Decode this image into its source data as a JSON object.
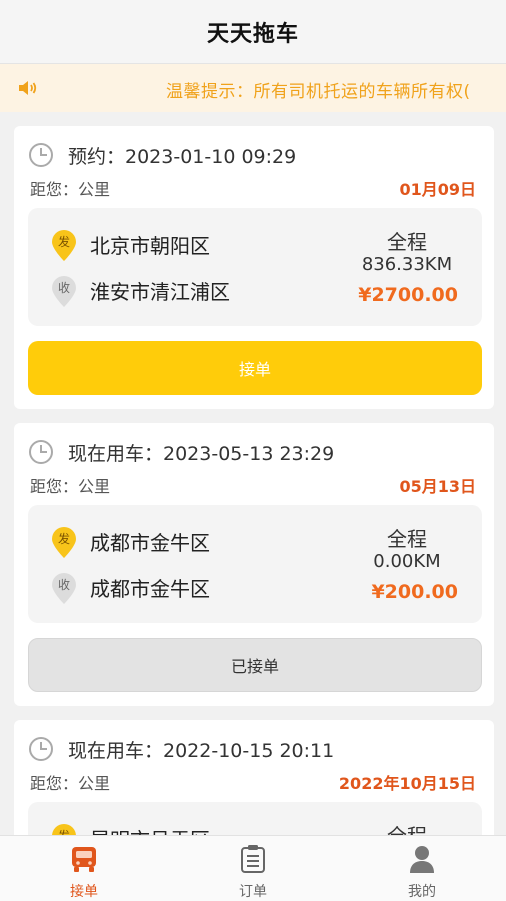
{
  "header": {
    "title": "天天拖车"
  },
  "notice": {
    "text": "温馨提示：所有司机托运的车辆所有权("
  },
  "orders": [
    {
      "time_label": "预约：2023-01-10 09:29",
      "distance_label": "距您：公里",
      "date": "01月09日",
      "from_badge": "发",
      "to_badge": "收",
      "from": "北京市朝阳区",
      "to": "淮安市清江浦区",
      "route_label": "全程",
      "route_distance": "836.33KM",
      "price": "¥2700.00",
      "button": "接单",
      "status": "accept"
    },
    {
      "time_label": "现在用车：2023-05-13 23:29",
      "distance_label": "距您：公里",
      "date": "05月13日",
      "from_badge": "发",
      "to_badge": "收",
      "from": "成都市金牛区",
      "to": "成都市金牛区",
      "route_label": "全程",
      "route_distance": "0.00KM",
      "price": "¥200.00",
      "button": "已接单",
      "status": "taken"
    },
    {
      "time_label": "现在用车：2022-10-15 20:11",
      "distance_label": "距您：公里",
      "date": "2022年10月15日",
      "from_badge": "发",
      "from": "昆明市呈贡区",
      "route_label": "全程"
    }
  ],
  "tabs": [
    {
      "label": "接单",
      "icon": "truck-icon",
      "active": true
    },
    {
      "label": "订单",
      "icon": "clipboard-icon",
      "active": false
    },
    {
      "label": "我的",
      "icon": "user-icon",
      "active": false
    }
  ],
  "colors": {
    "accent": "#ffcc0a",
    "date": "#e0561c",
    "price": "#f06a1e",
    "notice_text": "#f0a21b"
  }
}
